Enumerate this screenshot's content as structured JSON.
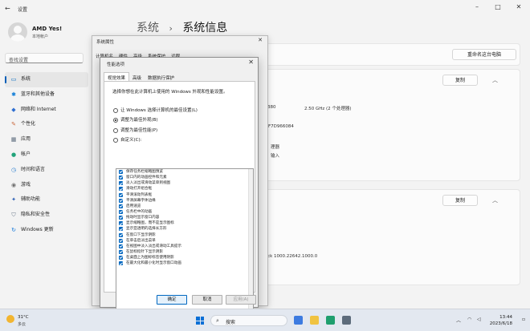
{
  "settings": {
    "app_title": "设置",
    "user_name": "AMD Yes!",
    "user_type": "本地帐户",
    "search_placeholder": "查找设置",
    "page_title": "系统",
    "page_subtitle": "系统信息",
    "breadcrumb_sep": "›",
    "rename_button": "重命名这台电脑",
    "copy_button_1": "复制",
    "copy_button_2": "复制",
    "spec_ram_fragment": "380",
    "spec_cpu": "2.50 GHz  (2 个处理器)",
    "spec_id_fragment": "49F7D966084",
    "spec_type_fragment": "理器",
    "spec_input_fragment": "输入",
    "spec_exp_fragment": "erPack 1000.22642.1000.0",
    "nav": [
      {
        "label": "系统",
        "icon": "system-icon",
        "active": true
      },
      {
        "label": "蓝牙和其他设备",
        "icon": "bluetooth-icon"
      },
      {
        "label": "网络和 Internet",
        "icon": "network-icon"
      },
      {
        "label": "个性化",
        "icon": "personalize-icon"
      },
      {
        "label": "应用",
        "icon": "apps-icon"
      },
      {
        "label": "帐户",
        "icon": "account-icon"
      },
      {
        "label": "时间和语言",
        "icon": "time-language-icon"
      },
      {
        "label": "游戏",
        "icon": "gaming-icon"
      },
      {
        "label": "辅助功能",
        "icon": "accessibility-icon"
      },
      {
        "label": "隐私和安全性",
        "icon": "privacy-icon"
      },
      {
        "label": "Windows 更新",
        "icon": "windows-update-icon"
      }
    ]
  },
  "sysprops": {
    "title": "系统属性",
    "tabs": [
      "计算机名",
      "硬件",
      "高级",
      "系统保护",
      "远程"
    ]
  },
  "perf": {
    "title": "性能选项",
    "tabs": [
      "视觉效果",
      "高级",
      "数据执行保护"
    ],
    "description": "选择你想在此计算机上使用的 Windows 外观和性能设置。",
    "radios": [
      {
        "label": "让 Windows 选择计算机的最佳设置(L)",
        "checked": false
      },
      {
        "label": "调整为最佳外观(B)",
        "checked": true
      },
      {
        "label": "调整为最佳性能(P)",
        "checked": false
      },
      {
        "label": "自定义(C):",
        "checked": false
      }
    ],
    "checkboxes": [
      "保存任务栏缩略图预览",
      "窗口内的动画控件和元素",
      "淡入淡出或滑动菜单到视图",
      "滑动打开组合框",
      "平滑滚动列表框",
      "平滑屏幕字体边缘",
      "启用速览",
      "任务栏中的动画",
      "拖动时显示窗口内容",
      "显示缩略图，而不是显示图标",
      "显示亚透明的选择长方形",
      "在窗口下显示阴影",
      "在单击后淡出菜单",
      "在视图中淡入淡出或滑动工具提示",
      "在鼠标指针下显示阴影",
      "在桌面上为图标标签使用阴影",
      "在最大化和最小化时显示窗口动画"
    ],
    "ok": "确定",
    "cancel": "取消",
    "apply": "应用(A)"
  },
  "taskbar": {
    "temp": "31°C",
    "weather": "多云",
    "search": "搜索",
    "time": "13:44",
    "date": "2023/6/18"
  }
}
